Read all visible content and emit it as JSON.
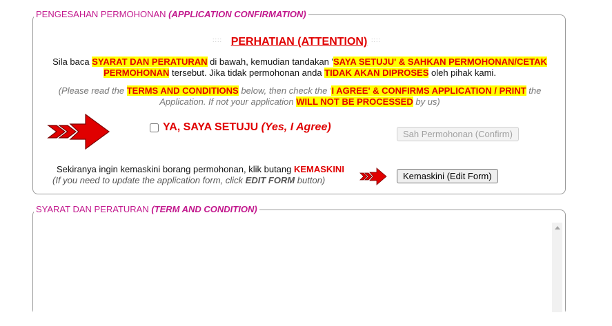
{
  "confirmation": {
    "legend_main": "PENGESAHAN PERMOHONAN ",
    "legend_sub": "(APPLICATION CONFIRMATION)",
    "dots": "::::",
    "attention_title": "PERHATIAN (ATTENTION)",
    "instruction_ms": {
      "t1": "Sila baca ",
      "h1": "SYARAT DAN PERATURAN",
      "t2": " di bawah, kemudian tandakan '",
      "h2a": "SAYA SETUJU' & SAHKAN PERMOHONAN/CETAK",
      "h2b": "PERMOHONAN",
      "t3": " tersebut. Jika tidak permohonan anda ",
      "h3": "TIDAK AKAN DIPROSES",
      "t4": " oleh pihak kami."
    },
    "instruction_en": {
      "t1": "(Please read the ",
      "h1": "TERMS AND CONDITIONS",
      "t2": " below, then check the '",
      "h2": "I AGREE' & CONFIRMS APPLICATION / PRINT",
      "t3": " the",
      "t4": "Application. If not your application ",
      "h3": "WILL NOT BE PROCESSED",
      "t5": " by  us)"
    },
    "agree_label": "YA, SAYA SETUJU ",
    "agree_label_en": "(Yes, I Agree)",
    "confirm_button": "Sah Permohonan (Confirm)",
    "update_ms": "Sekiranya ingin kemaskini borang permohonan, klik butang ",
    "update_ms_kw": "KEMASKINI",
    "update_en1": "(If you need to update the application form, click ",
    "update_en_kw": "EDIT FORM",
    "update_en2": " button)",
    "edit_button": "Kemaskini (Edit Form)"
  },
  "terms": {
    "legend_main": "SYARAT DAN PERATURAN ",
    "legend_sub": "(TERM AND CONDITION)"
  },
  "colors": {
    "legend": "#c2188d",
    "warning_red": "#e00000",
    "highlight": "#ffff00"
  }
}
